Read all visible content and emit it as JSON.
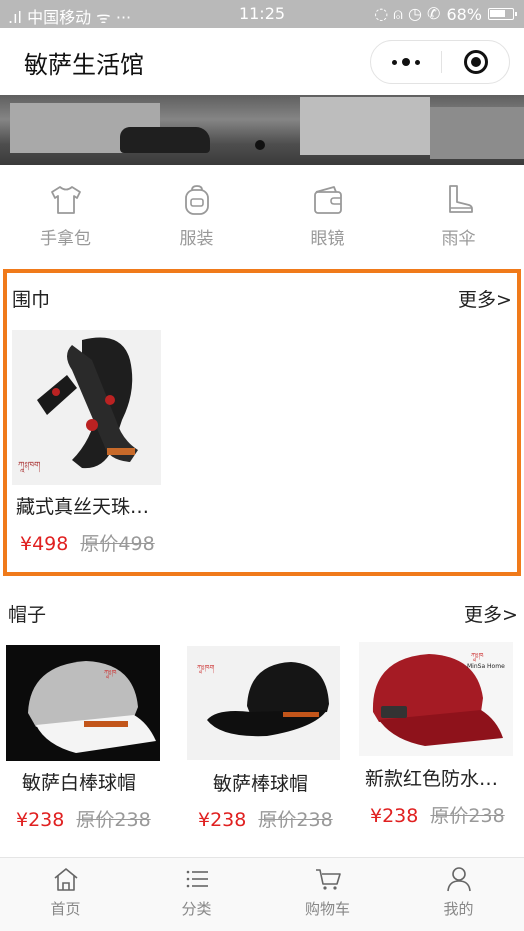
{
  "status_bar": {
    "carrier": "中国移动",
    "time": "11:25",
    "battery": "68%"
  },
  "nav": {
    "title": "敏萨生活馆"
  },
  "categories": [
    {
      "label": "手拿包",
      "icon": "tshirt-icon"
    },
    {
      "label": "服装",
      "icon": "backpack-icon"
    },
    {
      "label": "眼镜",
      "icon": "wallet-icon"
    },
    {
      "label": "雨伞",
      "icon": "boot-icon"
    }
  ],
  "sections": [
    {
      "title": "围巾",
      "more": "更多>",
      "products": [
        {
          "name": "藏式真丝天珠…",
          "price": "¥498",
          "original_price": "原价498"
        }
      ]
    },
    {
      "title": "帽子",
      "more": "更多>",
      "products": [
        {
          "name": "敏萨白棒球帽",
          "price": "¥238",
          "original_price": "原价238"
        },
        {
          "name": "敏萨棒球帽",
          "price": "¥238",
          "original_price": "原价238"
        },
        {
          "name": "新款红色防水…",
          "price": "¥238",
          "original_price": "原价238"
        }
      ]
    }
  ],
  "tabbar": [
    {
      "label": "首页",
      "icon": "home-icon"
    },
    {
      "label": "分类",
      "icon": "list-icon"
    },
    {
      "label": "购物车",
      "icon": "cart-icon"
    },
    {
      "label": "我的",
      "icon": "user-icon"
    }
  ],
  "colors": {
    "accent": "#f07a1a",
    "price": "#e02020",
    "muted": "#999999"
  }
}
